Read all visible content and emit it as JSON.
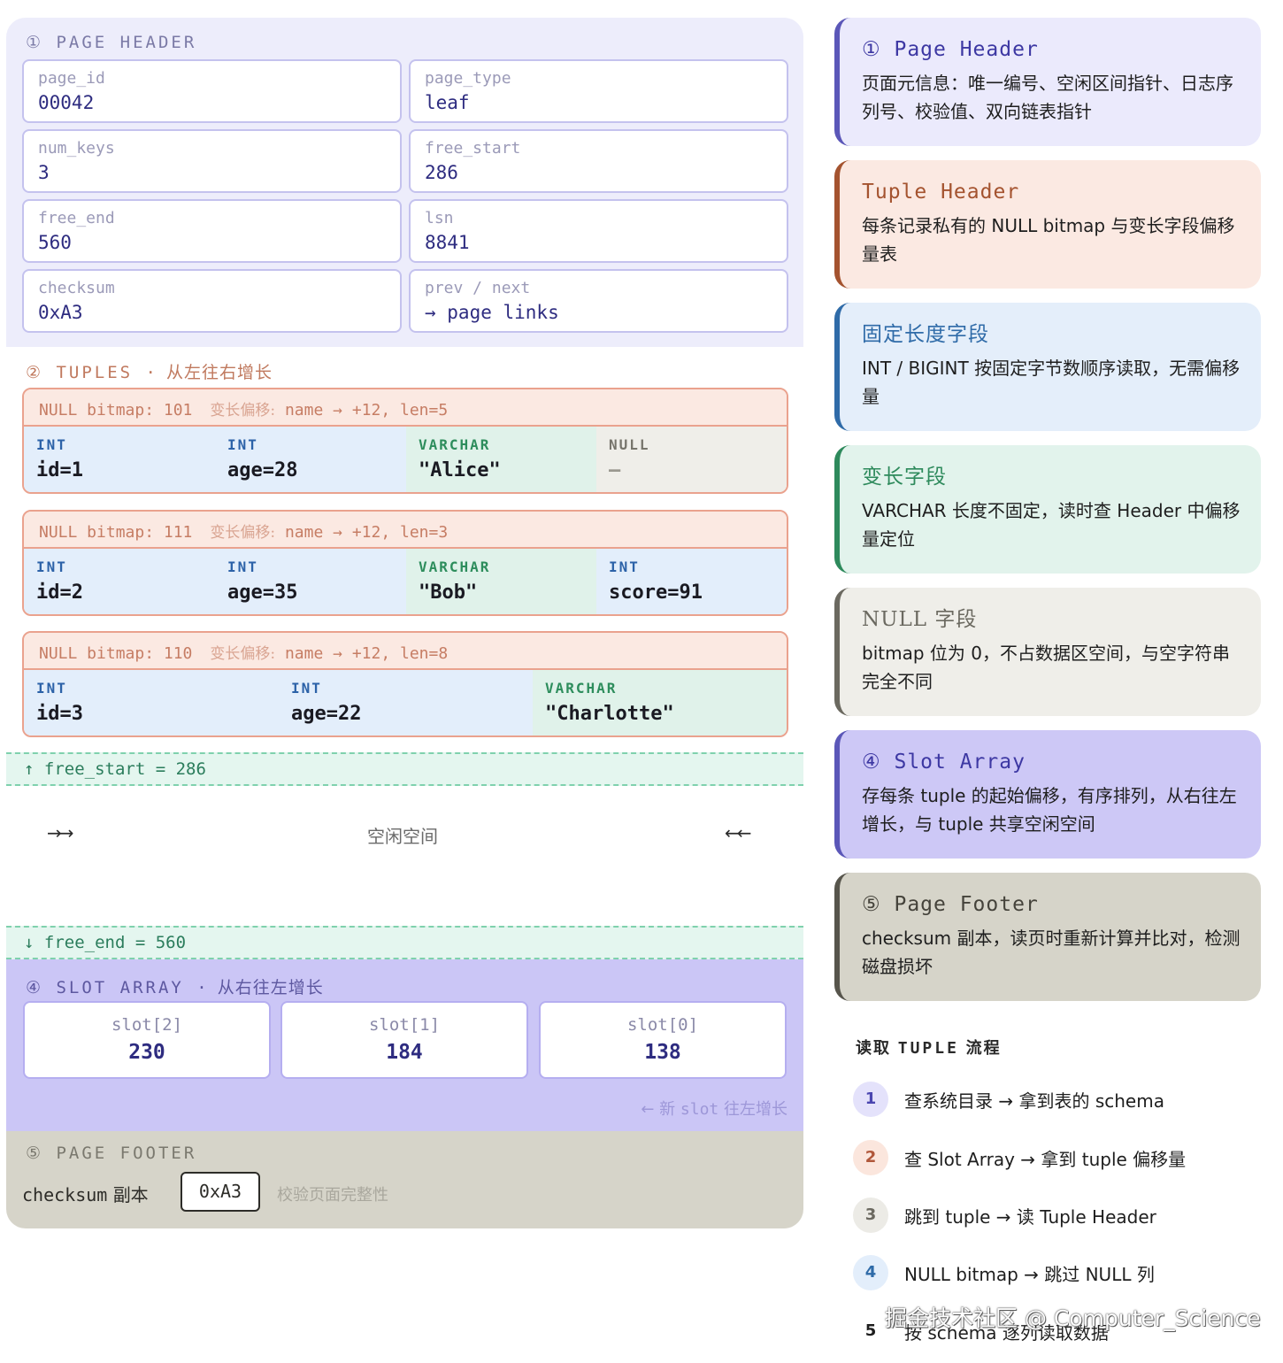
{
  "page_header": {
    "title": "① PAGE HEADER",
    "fields": [
      {
        "key": "page_id",
        "value": "00042"
      },
      {
        "key": "page_type",
        "value": "leaf"
      },
      {
        "key": "num_keys",
        "value": "3"
      },
      {
        "key": "free_start",
        "value": "286"
      },
      {
        "key": "free_end",
        "value": "560"
      },
      {
        "key": "lsn",
        "value": "8841"
      },
      {
        "key": "checksum",
        "value": "0xA3"
      },
      {
        "key": "prev / next",
        "value": "→ page links"
      }
    ]
  },
  "tuples": {
    "title_en": "② TUPLES ·",
    "title_cn": "从左往右增长",
    "offset_label": "变长偏移:",
    "rows": [
      {
        "bitmap": "NULL bitmap: 101",
        "offset": "name → +12, len=5",
        "cells": [
          {
            "type": "INT",
            "value": "id=1"
          },
          {
            "type": "INT",
            "value": "age=28"
          },
          {
            "type": "VARCHAR",
            "value": "\"Alice\""
          },
          {
            "type": "NULL",
            "value": "—"
          }
        ]
      },
      {
        "bitmap": "NULL bitmap: 111",
        "offset": "name → +12, len=3",
        "cells": [
          {
            "type": "INT",
            "value": "id=2"
          },
          {
            "type": "INT",
            "value": "age=35"
          },
          {
            "type": "VARCHAR",
            "value": "\"Bob\""
          },
          {
            "type": "INT",
            "value": "score=91"
          }
        ]
      },
      {
        "bitmap": "NULL bitmap: 110",
        "offset": "name → +12, len=8",
        "cells": [
          {
            "type": "INT",
            "value": "id=3"
          },
          {
            "type": "INT",
            "value": "age=22"
          },
          {
            "type": "VARCHAR",
            "value": "\"Charlotte\""
          }
        ]
      }
    ]
  },
  "free_space": {
    "start_marker": "↑ free_start = 286",
    "label": "空闲空间",
    "left_arrows": "→→",
    "right_arrows": "←←",
    "end_marker": "↓ free_end = 560"
  },
  "slot_array": {
    "title_en": "④ SLOT ARRAY ·",
    "title_cn": "从右往左增长",
    "slots": [
      {
        "key": "slot[2]",
        "value": "230"
      },
      {
        "key": "slot[1]",
        "value": "184"
      },
      {
        "key": "slot[0]",
        "value": "138"
      }
    ],
    "note_arrow": "←",
    "note_new": "新",
    "note_slot": "slot",
    "note_dir": "往左增长"
  },
  "page_footer": {
    "title": "⑤ PAGE FOOTER",
    "label_en": "checksum",
    "label_cn": "副本",
    "value": "0xA3",
    "note": "校验页面完整性"
  },
  "legend": [
    {
      "title": "① Page Header",
      "desc": "页面元信息：唯一编号、空闲区间指针、日志序列号、校验值、双向链表指针",
      "color": "#5b57b8"
    },
    {
      "title": "Tuple Header",
      "desc": "每条记录私有的 NULL bitmap 与变长字段偏移量表",
      "color": "#a4532f"
    },
    {
      "title": "固定长度字段",
      "desc": "INT / BIGINT 按固定字节数顺序读取，无需偏移量",
      "color": "#2f6ba8"
    },
    {
      "title": "变长字段",
      "desc": "VARCHAR 长度不固定，读时查 Header 中偏移量定位",
      "color": "#2e8a5c"
    },
    {
      "title": "NULL 字段",
      "desc": "bitmap 位为 0，不占数据区空间，与空字符串完全不同",
      "color": "#6b6960"
    },
    {
      "title": "④ Slot Array",
      "desc": "存每条 tuple 的起始偏移，有序排列，从右往左增长，与 tuple 共享空闲空间",
      "color": "#5b57b8"
    },
    {
      "title": "⑤ Page Footer",
      "desc": "checksum 副本，读页时重新计算并比对，检测磁盘损坏",
      "color": "#57554c"
    }
  ],
  "flow": {
    "title_a": "读取",
    "title_b": "TUPLE",
    "title_c": "流程",
    "steps": [
      {
        "n": "1",
        "text": "查系统目录 → 拿到表的 schema"
      },
      {
        "n": "2",
        "text": "查 Slot Array → 拿到 tuple 偏移量"
      },
      {
        "n": "3",
        "text": "跳到 tuple → 读 Tuple Header"
      },
      {
        "n": "4",
        "text": "NULL bitmap → 跳过 NULL 列"
      },
      {
        "n": "5",
        "text": "按 schema 逐列读取数据"
      }
    ]
  },
  "watermark": "掘金技术社区 @ Computer_Science"
}
